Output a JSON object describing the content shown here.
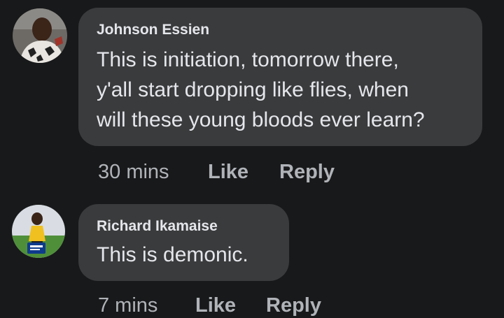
{
  "comments": [
    {
      "author": "Johnson Essien",
      "lines": [
        "This is initiation, tomorrow there,",
        "y'all start dropping like flies, when",
        "will these young bloods ever learn?"
      ],
      "time": "30 mins",
      "like_label": "Like",
      "reply_label": "Reply"
    },
    {
      "author": "Richard Ikamaise",
      "lines": [
        "This is demonic."
      ],
      "time": "7 mins",
      "like_label": "Like",
      "reply_label": "Reply"
    }
  ],
  "colors": {
    "background": "#18191a",
    "bubble": "#3a3b3c",
    "primary_text": "#e4e6eb",
    "secondary_text": "#b0b3b8"
  },
  "icons": [
    "avatar-johnson-essien",
    "avatar-richard-ikamaise"
  ]
}
